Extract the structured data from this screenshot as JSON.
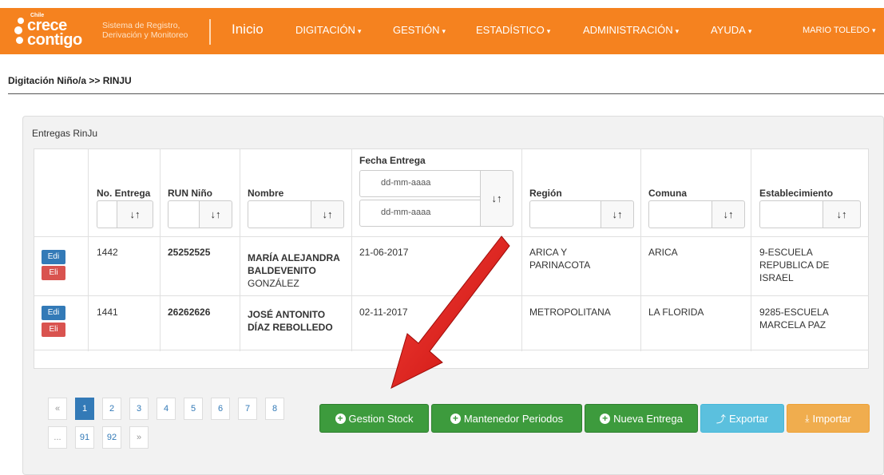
{
  "navbar": {
    "logo_chile": "Chile",
    "logo_crece": "crece",
    "logo_contigo": "contigo",
    "subtitle_line1": "Sistema de Registro,",
    "subtitle_line2": "Derivación y Monitoreo",
    "items": [
      {
        "label": "Inicio"
      },
      {
        "label": "DIGITACIÓN"
      },
      {
        "label": "GESTIÓN"
      },
      {
        "label": "ESTADÍSTICO"
      },
      {
        "label": "ADMINISTRACIÓN"
      },
      {
        "label": "AYUDA"
      },
      {
        "label": "MARIO TOLEDO"
      }
    ],
    "bg_color": "#f5821f"
  },
  "breadcrumb": "Digitación Niño/a >> RINJU",
  "panel": {
    "title": "Entregas RinJu",
    "columns": {
      "no_entrega": "No. Entrega",
      "run_nino": "RUN Niño",
      "nombre": "Nombre",
      "fecha_entrega": "Fecha Entrega",
      "region": "Región",
      "comuna": "Comuna",
      "establecimiento": "Establecimiento"
    },
    "date_placeholder_from": "dd-mm-aaaa",
    "date_placeholder_to": "dd-mm-aaaa",
    "sort_icon": "↓↑",
    "rows": [
      {
        "edit_label": "Edi",
        "delete_label": "Eli",
        "no_entrega": "1442",
        "run": "25252525",
        "nombre_1": "MARÍA ALEJANDRA",
        "nombre_2": "BALDEVENITO",
        "nombre_3": "GONZÁLEZ",
        "fecha": "21-06-2017",
        "region_1": "ARICA Y",
        "region_2": "PARINACOTA",
        "comuna": "ARICA",
        "estab_1": "9-ESCUELA",
        "estab_2": "REPUBLICA DE",
        "estab_3": "ISRAEL"
      },
      {
        "edit_label": "Edi",
        "delete_label": "Eli",
        "no_entrega": "1441",
        "run": "26262626",
        "nombre_1": "JOSÉ ANTONITO",
        "nombre_2": "DÍAZ REBOLLEDO",
        "fecha": "02-11-2017",
        "region_1": "METROPOLITANA",
        "comuna": "LA FLORIDA",
        "estab_1": "9285-ESCUELA",
        "estab_2": "MARCELA PAZ"
      }
    ]
  },
  "pagination": {
    "prev": "«",
    "next": "»",
    "ellipsis": "...",
    "pages": [
      "1",
      "2",
      "3",
      "4",
      "5",
      "6",
      "7",
      "8",
      "91",
      "92"
    ],
    "active": "1"
  },
  "actions": {
    "gestion_stock": "Gestion Stock",
    "mantenedor": "Mantenedor Periodos",
    "nueva_entrega": "Nueva Entrega",
    "exportar": "Exportar",
    "importar": "Importar"
  }
}
